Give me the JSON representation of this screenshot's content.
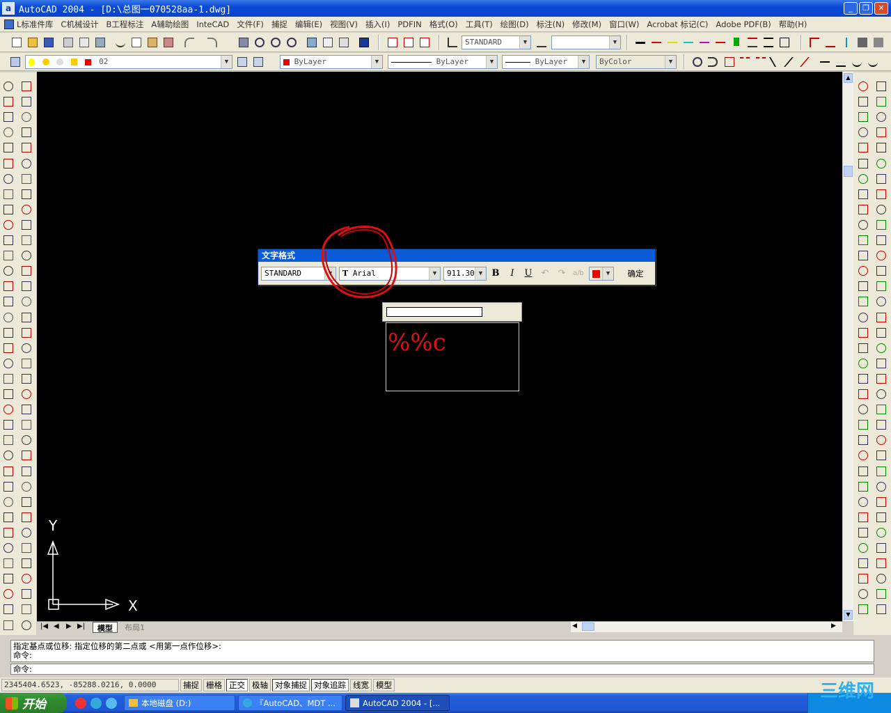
{
  "window": {
    "title": "AutoCAD 2004 - [D:\\总图一070528aa-1.dwg]",
    "min": "_",
    "max": "❐",
    "close": "✕"
  },
  "menu": [
    "L标准件库",
    "C机械设计",
    "B工程标注",
    "A辅助绘图",
    "InteCAD",
    "文件(F)",
    "捕捉",
    "编辑(E)",
    "视图(V)",
    "插入(I)",
    "PDFIN",
    "格式(O)",
    "工具(T)",
    "绘图(D)",
    "标注(N)",
    "修改(M)",
    "窗口(W)",
    "Acrobat 标记(C)",
    "Adobe PDF(B)",
    "帮助(H)"
  ],
  "toolbar": {
    "text_style": "STANDARD",
    "layer": "02",
    "color": "ByLayer",
    "linetype": "ByLayer",
    "lineweight": "ByLayer",
    "plotstyle": "ByColor"
  },
  "text_format": {
    "title": "文字格式",
    "style": "STANDARD",
    "font": "Arial",
    "height": "911.304",
    "bold": "B",
    "italic": "I",
    "underline": "U",
    "ok": "确定"
  },
  "mtext": {
    "content": "%%c"
  },
  "ucs": {
    "x_label": "X",
    "y_label": "Y"
  },
  "tabs": {
    "model": "模型",
    "layout": "布局1"
  },
  "command": {
    "history_line1": "指定基点或位移: 指定位移的第二点或 <用第一点作位移>:",
    "history_line2": "命令:",
    "prompt": "命令:"
  },
  "status": {
    "coords": "2345404.6523, -85288.0216, 0.0000",
    "buttons": [
      "捕捉",
      "栅格",
      "正交",
      "极轴",
      "对象捕捉",
      "对象追踪",
      "线宽",
      "模型"
    ]
  },
  "taskbar": {
    "start": "开始",
    "tasks": [
      "本地磁盘 (D:)",
      "『AutoCAD、MDT ...",
      "AutoCAD 2004 - [..."
    ]
  },
  "watermark": "三维网",
  "colors": {
    "title_blue": "#0b4ad7",
    "canvas": "#000000",
    "mtext_red": "#e01010"
  }
}
